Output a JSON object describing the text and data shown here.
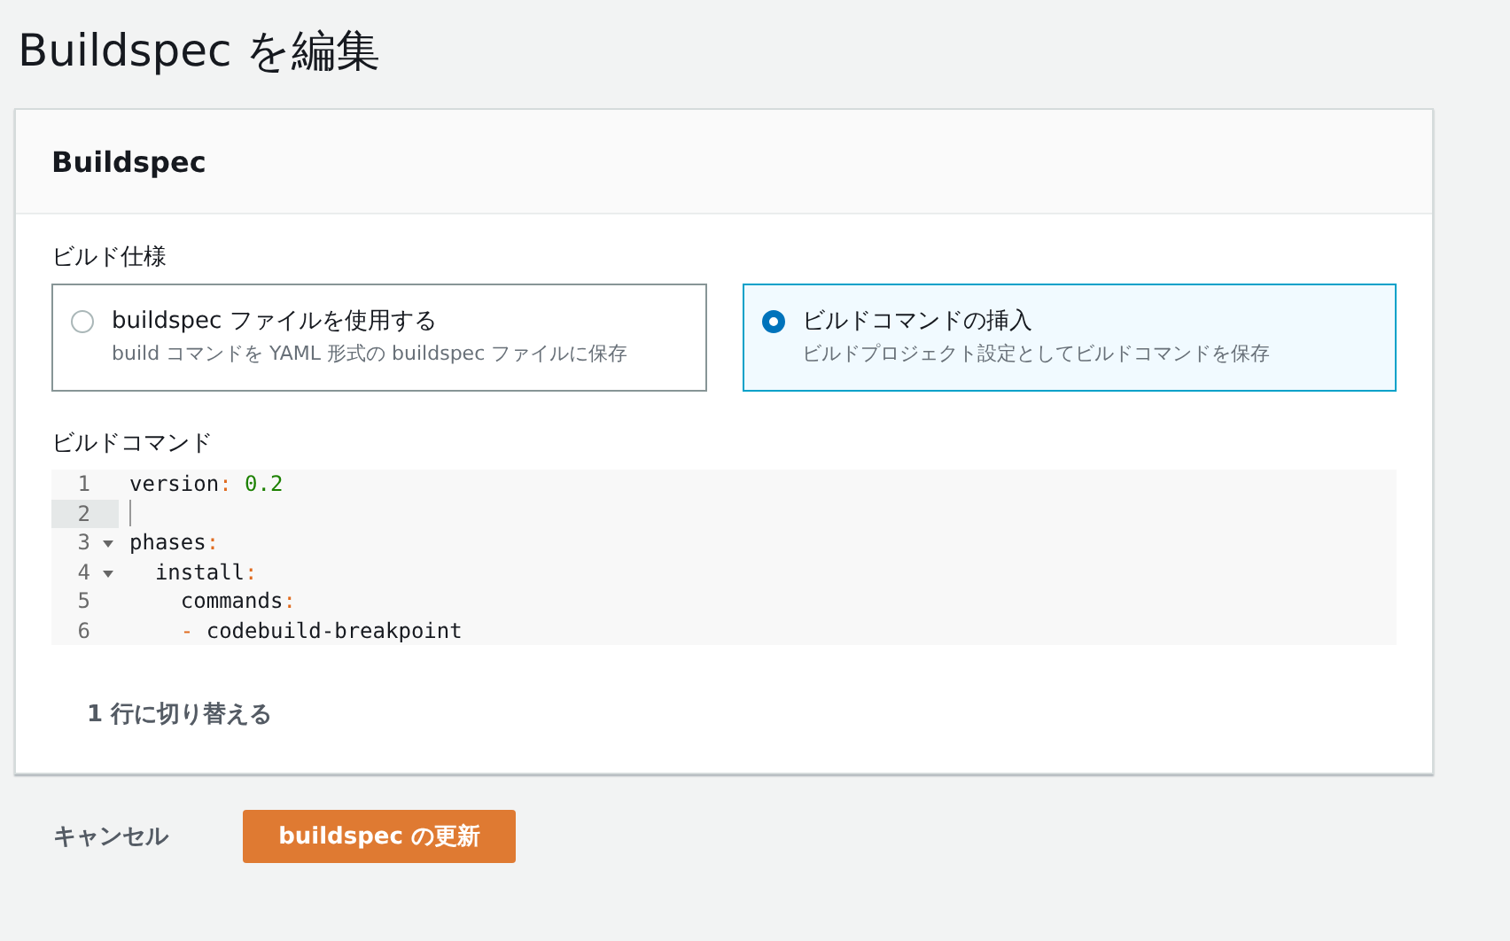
{
  "page_title": "Buildspec を編集",
  "card": {
    "title": "Buildspec",
    "spec_label": "ビルド仕様",
    "options": [
      {
        "label": "buildspec ファイルを使用する",
        "description": "build コマンドを YAML 形式の buildspec ファイルに保存",
        "selected": false
      },
      {
        "label": "ビルドコマンドの挿入",
        "description": "ビルドプロジェクト設定としてビルドコマンドを保存",
        "selected": true
      }
    ],
    "commands_label": "ビルドコマンド",
    "editor": {
      "lines": [
        {
          "number": "1",
          "foldable": false,
          "active": false,
          "tokens": [
            {
              "kind": "key",
              "text": "version"
            },
            {
              "kind": "punct",
              "text": ": "
            },
            {
              "kind": "number",
              "text": "0.2"
            }
          ]
        },
        {
          "number": "2",
          "foldable": false,
          "active": true
        },
        {
          "number": "3",
          "foldable": true,
          "active": false,
          "tokens": [
            {
              "kind": "key",
              "text": "phases"
            },
            {
              "kind": "punct",
              "text": ":"
            }
          ]
        },
        {
          "number": "4",
          "foldable": true,
          "active": false,
          "tokens": [
            {
              "kind": "key",
              "text": "  install"
            },
            {
              "kind": "punct",
              "text": ":"
            }
          ]
        },
        {
          "number": "5",
          "foldable": false,
          "active": false,
          "tokens": [
            {
              "kind": "key",
              "text": "    commands"
            },
            {
              "kind": "punct",
              "text": ":"
            }
          ]
        },
        {
          "number": "6",
          "foldable": false,
          "active": false,
          "tokens": [
            {
              "kind": "punct",
              "text": "    - "
            },
            {
              "kind": "key",
              "text": "codebuild-breakpoint"
            }
          ]
        }
      ]
    },
    "toggle_link": "1 行に切り替える"
  },
  "buttons": [
    {
      "kind": "link",
      "label": "キャンセル"
    },
    {
      "kind": "primary",
      "label": "buildspec の更新"
    }
  ]
}
